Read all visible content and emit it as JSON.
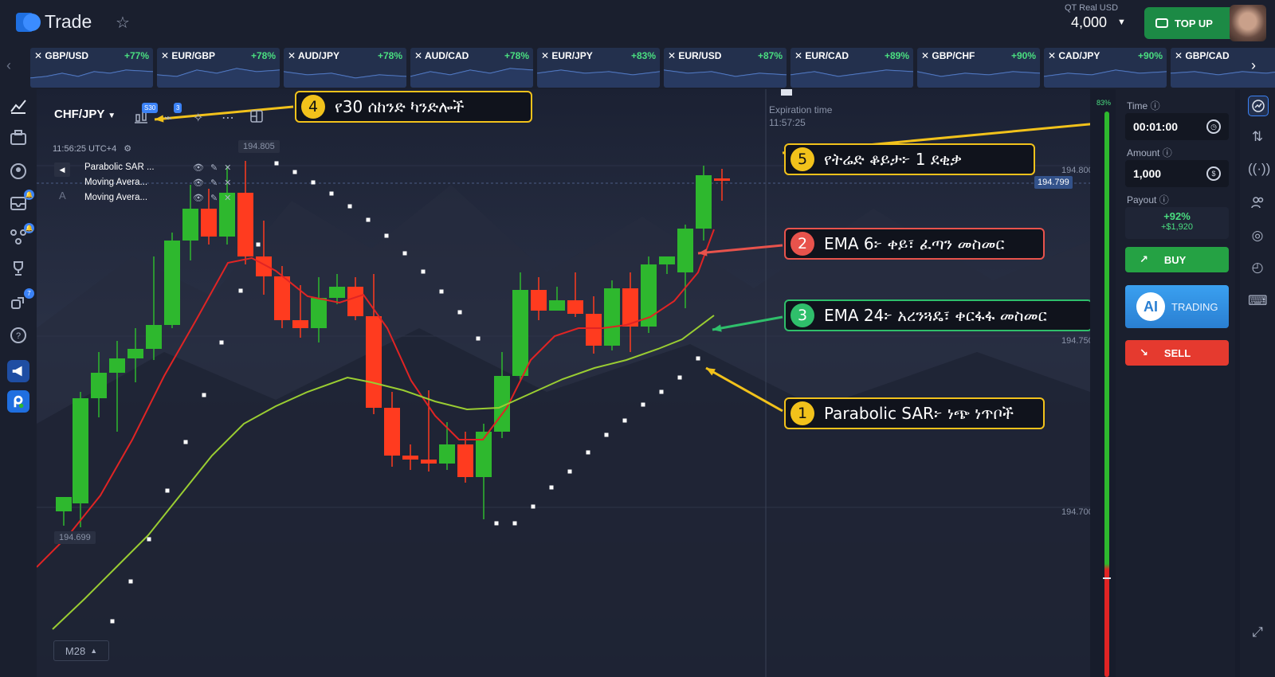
{
  "header": {
    "logo_text": "Trade",
    "account_label": "QT Real  USD",
    "balance": "4,000",
    "topup_label": "TOP UP"
  },
  "pairs": [
    {
      "name": "GBP/USD",
      "payout": "+77%"
    },
    {
      "name": "EUR/GBP",
      "payout": "+78%"
    },
    {
      "name": "AUD/JPY",
      "payout": "+78%"
    },
    {
      "name": "AUD/CAD",
      "payout": "+78%"
    },
    {
      "name": "EUR/JPY",
      "payout": "+83%"
    },
    {
      "name": "EUR/USD",
      "payout": "+87%"
    },
    {
      "name": "EUR/CAD",
      "payout": "+89%"
    },
    {
      "name": "GBP/CHF",
      "payout": "+90%"
    },
    {
      "name": "CAD/JPY",
      "payout": "+90%"
    },
    {
      "name": "GBP/CAD",
      "payout": ""
    }
  ],
  "left_rail": {
    "badge_notifications": "",
    "badge_social": "7"
  },
  "chart_toolbar": {
    "asset": "CHF/JPY",
    "candle_badge": "S30",
    "indicator_badge": "3"
  },
  "chart": {
    "server_time": "11:56:25 UTC+4",
    "indicators": [
      "Parabolic SAR ...",
      "Moving Avera...",
      "Moving Avera..."
    ],
    "price_labels": [
      "194.800",
      "194.750",
      "194.700"
    ],
    "current_price": "194.799",
    "high_label": "194.805",
    "low_label": "194.699",
    "expiration_label": "Expiration time",
    "expiration_time": "11:57:25",
    "timeframe": "M28",
    "progress_pct": "83%"
  },
  "callouts": {
    "c1_num": "1",
    "c1_text": "Parabolic SAR፦ ነጭ ነጥቦች",
    "c2_num": "2",
    "c2_text": "EMA 6፦ ቀይ፣ ፈጣን መስመር",
    "c3_num": "3",
    "c3_text": "EMA 24፦ አረንጓዴ፣ ቀርፋፋ መስመር",
    "c4_num": "4",
    "c4_text": "የ30 ሰከንድ ካንድሎች",
    "c5_num": "5",
    "c5_text": "የትሬድ ቆይታ፦ 1 ደቂቃ"
  },
  "trade_panel": {
    "time_label": "Time",
    "time_value": "00:01:00",
    "amount_label": "Amount",
    "amount_value": "1,000",
    "payout_label": "Payout",
    "payout_pct": "+92%",
    "payout_amount": "+$1,920",
    "buy_label": "BUY",
    "ai_label": "AI",
    "ai_sub": "TRADING",
    "sell_label": "SELL"
  },
  "colors": {
    "bull_candle": "#2eb82e",
    "bear_candle": "#ff3b1f",
    "ema_fast": "#e02424",
    "ema_slow": "#9acd32",
    "sar_dots": "#ffffff",
    "callout_yellow": "#f2c21b",
    "callout_red": "#e8534c",
    "callout_green": "#2fbf6b"
  },
  "icons": [
    "star-icon",
    "wallet-icon",
    "chart-icon",
    "briefcase-icon",
    "user-icon",
    "inbox-icon",
    "social-icon",
    "trophy-icon",
    "share-icon",
    "help-icon",
    "megaphone-icon",
    "app-icon",
    "clock-icon",
    "dollar-icon",
    "swap-icon",
    "signal-icon",
    "people-icon",
    "target-icon",
    "history-icon",
    "keyboard-icon",
    "fullscreen-icon"
  ]
}
